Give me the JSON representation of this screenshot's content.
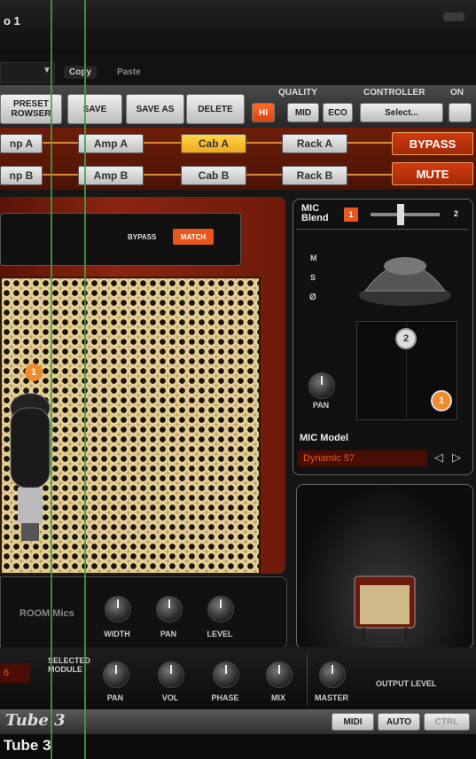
{
  "window": {
    "title": "o 1"
  },
  "menubar": {
    "copy_label": "Copy",
    "paste_label": "Paste"
  },
  "toolbar": {
    "preset_browser_label": "PRESET\nROWSER",
    "save_label": "SAVE",
    "save_as_label": "SAVE AS",
    "delete_label": "DELETE",
    "quality_label": "QUALITY",
    "quality_options": [
      "HI",
      "MID",
      "ECO"
    ],
    "quality_selected": "HI",
    "controller_label": "CONTROLLER",
    "controller_select_label": "Select...",
    "on_label": "ON"
  },
  "signal_chain": {
    "col1": [
      "np A",
      "np B"
    ],
    "amps": [
      "Amp A",
      "Amp B"
    ],
    "cabs": [
      "Cab A",
      "Cab B"
    ],
    "selected": "Cab A",
    "racks": [
      "Rack A",
      "Rack B"
    ],
    "bypass_label": "BYPASS",
    "mute_label": "MUTE"
  },
  "cabinet": {
    "bypass_label": "BYPASS",
    "match_label": "MATCH",
    "mic_badge": "1"
  },
  "mic_panel": {
    "blend_label": "MIC\nBlend",
    "blend_left": "1",
    "blend_right": "2",
    "options": [
      "M",
      "S",
      "Ø"
    ],
    "pan_label": "PAN",
    "mic_model_label": "MIC Model",
    "mic_model_value": "Dynamic 57",
    "badge_2": "2",
    "badge_1": "1"
  },
  "room": {
    "label": "ROOM Mics",
    "knobs": [
      "WIDTH",
      "PAN",
      "LEVEL"
    ]
  },
  "bottom": {
    "selected_module_label": "SELECTED\nMODULE",
    "knobs": [
      "PAN",
      "VOL",
      "PHASE",
      "MIX"
    ],
    "master_label": "MASTER",
    "output_level_label": "OUTPUT LEVEL",
    "left_value": "6"
  },
  "footer": {
    "logo": "Tube 3",
    "buttons": [
      "MIDI",
      "AUTO",
      "CTRL"
    ]
  },
  "caption": {
    "text": "Tube 3"
  }
}
